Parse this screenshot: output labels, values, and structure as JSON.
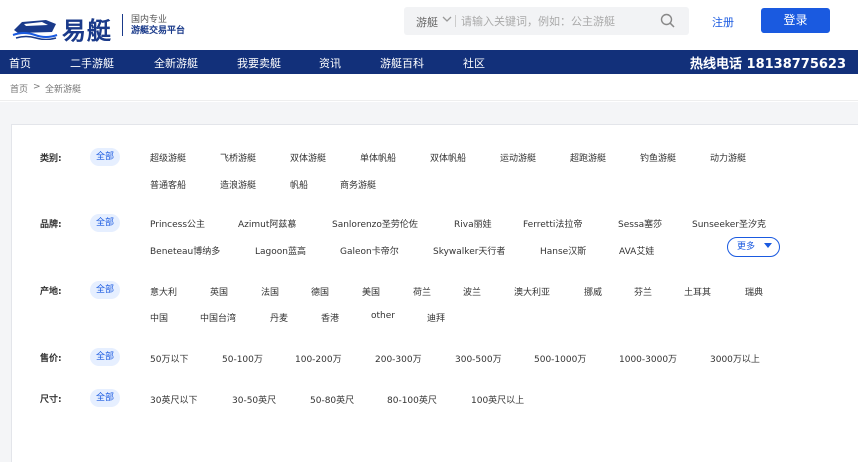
{
  "header": {
    "logo_text": "易艇",
    "slogan_line1": "国内专业",
    "slogan_line2": "游艇交易平台",
    "search_category": "游艇",
    "search_placeholder": "请输入关键词，例如：公主游艇",
    "register_label": "注册",
    "login_label": "登录"
  },
  "nav": {
    "items": [
      {
        "label": "首页"
      },
      {
        "label": "二手游艇"
      },
      {
        "label": "全新游艇"
      },
      {
        "label": "我要卖艇"
      },
      {
        "label": "资讯"
      },
      {
        "label": "游艇百科"
      },
      {
        "label": "社区"
      }
    ],
    "active_index": 2,
    "hotline": "热线电话 18138775623"
  },
  "breadcrumb": {
    "home": "首页",
    "separator": ">",
    "current": "全新游艇"
  },
  "filters": {
    "all_label": "全部",
    "more_label": "更多",
    "category": {
      "label": "类别:",
      "options": [
        "超级游艇",
        "飞桥游艇",
        "双体游艇",
        "单体帆船",
        "双体帆船",
        "运动游艇",
        "超跑游艇",
        "钓鱼游艇",
        "动力游艇",
        "普通客船",
        "造浪游艇",
        "帆船",
        "商务游艇"
      ]
    },
    "brand": {
      "label": "品牌:",
      "options": [
        "Princess公主",
        "Azimut阿兹慕",
        "Sanlorenzo圣劳伦佐",
        "Riva丽娃",
        "Ferretti法拉帝",
        "Sessa塞莎",
        "Sunseeker圣汐克",
        "Beneteau博纳多",
        "Lagoon蓝高",
        "Galeon卡帝尔",
        "Skywalker天行者",
        "Hanse汉斯",
        "AVA艾娃"
      ]
    },
    "origin": {
      "label": "产地:",
      "options": [
        "意大利",
        "英国",
        "法国",
        "德国",
        "美国",
        "荷兰",
        "波兰",
        "澳大利亚",
        "挪威",
        "芬兰",
        "土耳其",
        "瑞典",
        "中国",
        "中国台湾",
        "丹麦",
        "香港",
        "other",
        "迪拜"
      ]
    },
    "price": {
      "label": "售价:",
      "options": [
        "50万以下",
        "50-100万",
        "100-200万",
        "200-300万",
        "300-500万",
        "500-1000万",
        "1000-3000万",
        "3000万以上"
      ]
    },
    "size": {
      "label": "尺寸:",
      "options": [
        "30英尺以下",
        "30-50英尺",
        "50-80英尺",
        "80-100英尺",
        "100英尺以上"
      ]
    }
  },
  "colors": {
    "brand": "#12307a",
    "accent": "#1a5ae0",
    "pill_bg": "#e6efff"
  },
  "icons": {
    "logo": "yacht-logo-icon",
    "search": "search-icon",
    "chevron": "chevron-down-icon",
    "more_caret": "caret-down-icon"
  }
}
